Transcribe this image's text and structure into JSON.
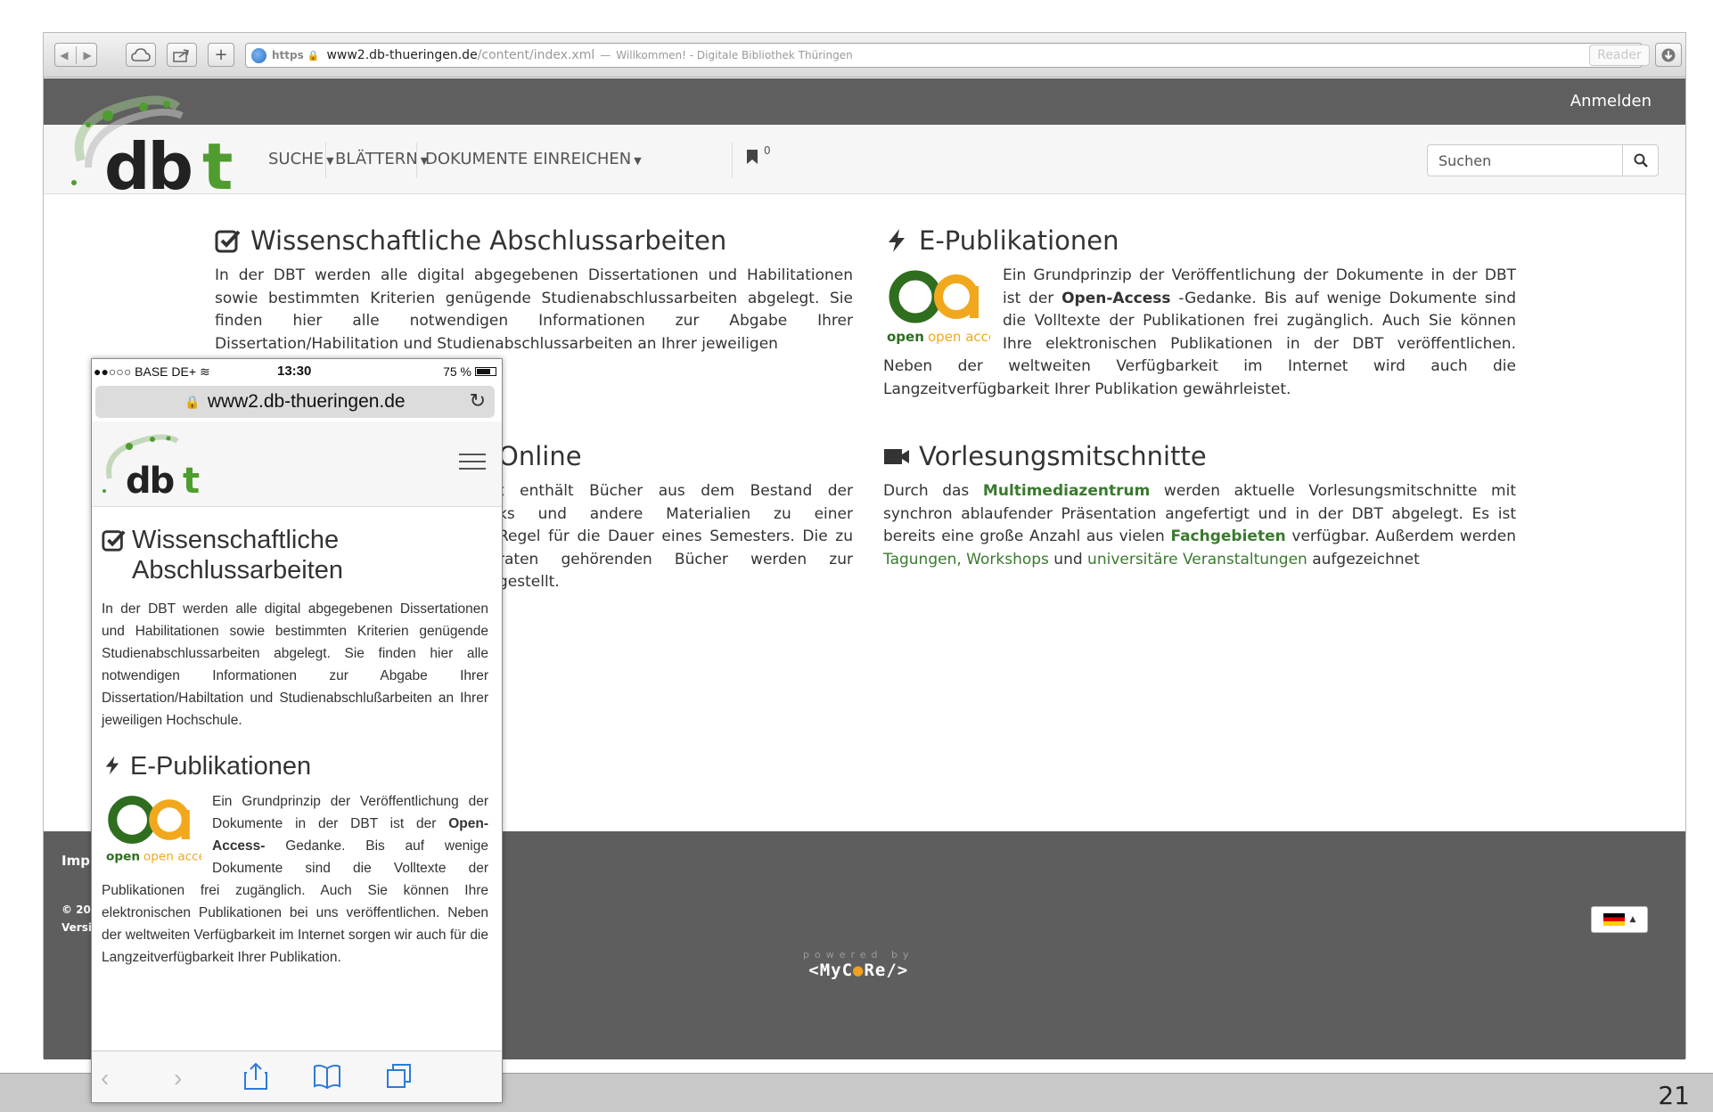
{
  "browser": {
    "url_scheme": "https",
    "url_host": "www2.db-thueringen.de",
    "url_path": "/content/index.xml",
    "url_separator": "—",
    "page_title": "Willkommen! - Digitale Bibliothek Thüringen",
    "reader_label": "Reader"
  },
  "header": {
    "login_label": "Anmelden"
  },
  "logo": {
    "text": "dbt"
  },
  "nav": {
    "items": [
      {
        "label": "SUCHE"
      },
      {
        "label": "BLÄTTERN"
      },
      {
        "label": "DOKUMENTE EINREICHEN"
      }
    ],
    "bookmark_count": "0",
    "search_placeholder": "Suchen"
  },
  "sections": {
    "abschluss": {
      "title": "Wissenschaftliche Abschlussarbeiten",
      "text": "In der DBT werden alle digital abgegebenen Dissertationen und Habilitationen sowie bestimmten Kriterien genügende Studienabschlussarbeiten abgelegt. Sie finden hier alle notwendigen Informationen zur Abgabe Ihrer Dissertation/Habilitation und Studienabschlussarbeiten an Ihrer jeweiligen"
    },
    "epub": {
      "title": "E-Publikationen",
      "oa_label": "open access",
      "text_1": "Ein Grundprinzip der Veröffentlichung der Dokumente in der DBT ist der",
      "text_bold": "Open-Access",
      "text_2": "-Gedanke. Bis auf wenige Dokumente sind die Volltexte der Publikationen frei zugänglich. Auch Sie können Ihre elektronischen Publikationen in der DBT veröffentlichen. Neben der weltweiten Verfügbarkeit im Internet wird auch die Langzeitverfügbarkeit Ihrer Publikation gewährleistet."
    },
    "online": {
      "title": "Online",
      "lines": [
        "t enthält Bücher aus dem Bestand der",
        "ks und andere Materialien zu einer",
        "Regel für die Dauer eines Semesters. Die zu",
        "raten gehörenden Bücher werden zur",
        "gestellt."
      ]
    },
    "vorlesung": {
      "title": "Vorlesungsmitschnitte",
      "t1": "Durch das",
      "l1": "Multimediazentrum",
      "t2": "werden aktuelle Vorlesungsmitschnitte mit synchron ablaufender Präsentation angefertigt und in der DBT abgelegt. Es ist bereits eine große Anzahl aus vielen",
      "l2": "Fachgebieten",
      "t3": "verfügbar. Außerdem werden",
      "l3": "Tagungen, Workshops",
      "t4": "und",
      "l4": "universitäre Veranstaltungen",
      "t5": "aufgezeichnet"
    }
  },
  "footer": {
    "impr": "Impr",
    "copy_line1": "© 20",
    "copy_line2": "Versi",
    "powered_by": "powered by",
    "mycore_pre": "<MyC",
    "mycore_dot": "●",
    "mycore_post": "Re/>"
  },
  "slide": {
    "number": "21"
  },
  "phone": {
    "carrier": "●●○○○ BASE DE+",
    "time": "13:30",
    "battery": "75 %",
    "battery_level": 0.75,
    "url": "www2.db-thueringen.de",
    "abschluss_title": "Wissenschaftliche Abschlussarbeiten",
    "abschluss_text": "In der DBT werden alle digital abgegebenen Dissertationen und Habilitationen sowie bestimmten Kriterien genügende Studienabschlussarbeiten abgelegt. Sie finden hier alle notwendigen Informationen zur Abgabe Ihrer Dissertation/Habiltation und Studienabschlußarbeiten an Ihrer jeweiligen Hochschule.",
    "epub_title": "E-Publikationen",
    "epub_oa_label": "open access",
    "epub_t1": "Ein Grundprinzip der Veröffentlichung der Dokumente in der DBT ist der",
    "epub_bold": "Open-Access-",
    "epub_t2": "Gedanke. Bis auf wenige Dokumente sind die Volltexte der Publikationen frei zugänglich. Auch Sie können Ihre elektronischen Publikationen bei uns veröffentlichen. Neben der weltweiten Verfügbarkeit im Internet sorgen wir auch für die Langzeitverfügbarkeit Ihrer Publikation."
  },
  "colors": {
    "link_green": "#3a7a2e",
    "dark_gray": "#5f5f5f",
    "oa_green": "#2f6d1f",
    "oa_orange": "#f2a81d"
  }
}
